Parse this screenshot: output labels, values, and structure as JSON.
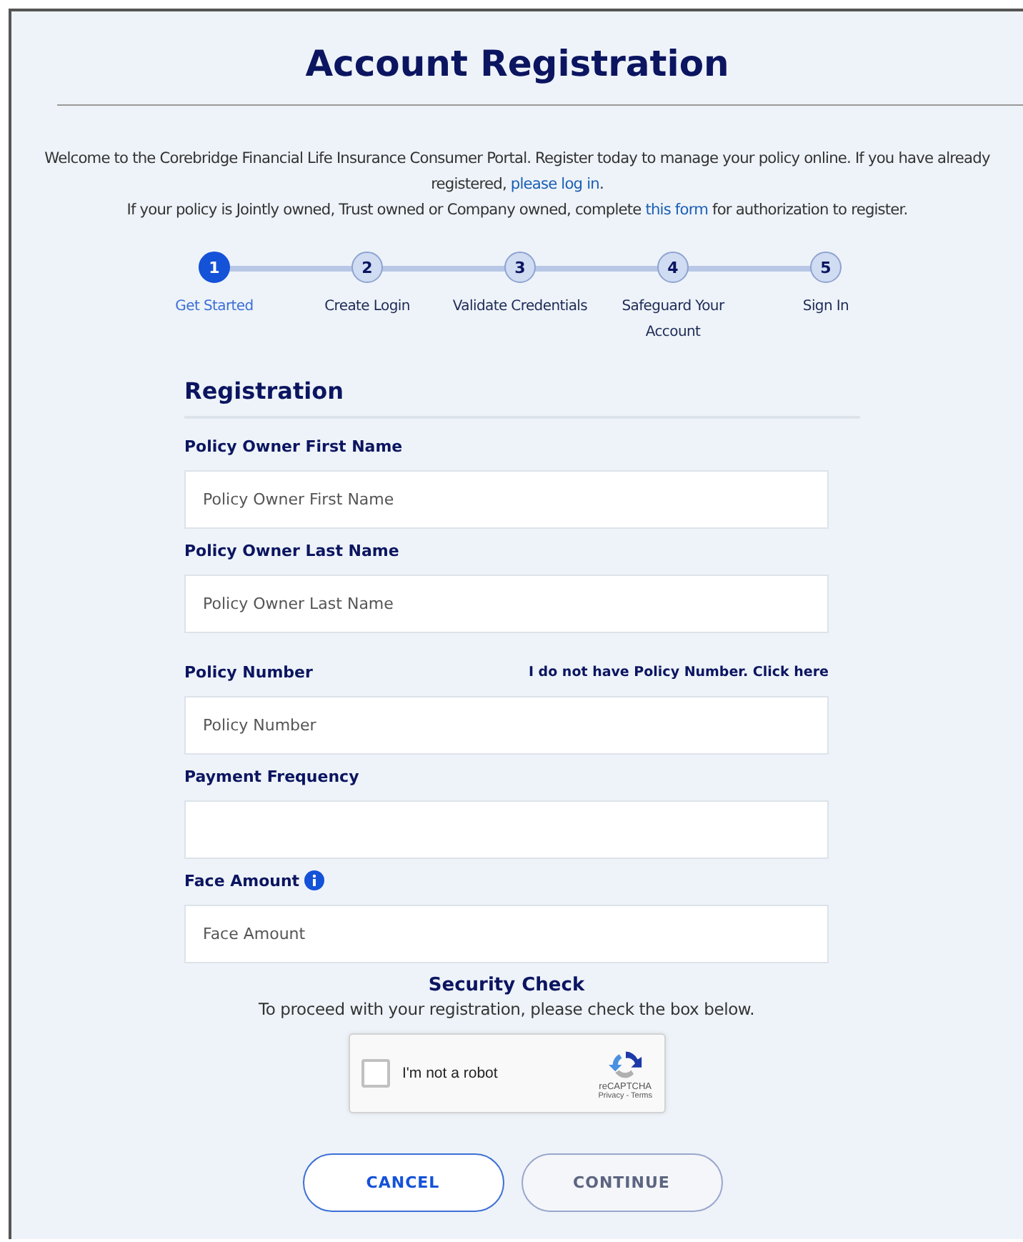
{
  "title": "Account Registration",
  "intro": {
    "text": "Welcome to the Corebridge Financial Life Insurance Consumer Portal. Register today to manage your policy online. If you have already registered, ",
    "link": "please log in",
    "after": "."
  },
  "intro2": {
    "text": "If your policy is Jointly owned, Trust owned or Company owned, complete ",
    "link": "this form",
    "after": " for authorization to register."
  },
  "steps": [
    {
      "number": "1",
      "label": "Get Started",
      "selected": true
    },
    {
      "number": "2",
      "label": "Create Login",
      "selected": false
    },
    {
      "number": "3",
      "label": "Validate Credentials",
      "selected": false
    },
    {
      "number": "4",
      "label": "Safeguard Your Account",
      "selected": false
    },
    {
      "number": "5",
      "label": "Sign In",
      "selected": false
    }
  ],
  "section_title": "Registration",
  "fields": [
    {
      "label": "Policy Owner First Name",
      "placeholder": "Policy Owner First Name"
    },
    {
      "label": "Policy Owner Last Name",
      "placeholder": "Policy Owner Last Name"
    },
    {
      "label": "Policy Number",
      "placeholder": "Policy Number",
      "link": "I do not have Policy Number. Click here"
    },
    {
      "label": "Payment Frequency"
    },
    {
      "label": "Face Amount",
      "placeholder": "Face Amount",
      "info": true
    }
  ],
  "security": {
    "title": "Security Check",
    "text": "To proceed with your registration, please check the box below.",
    "checkbox_label": "I'm not a robot",
    "checked": false,
    "brand": "reCAPTCHA",
    "terms": "Privacy - Terms"
  },
  "buttons": [
    {
      "label": "CANCEL",
      "disabled": false
    },
    {
      "label": "CONTINUE",
      "disabled": true
    }
  ]
}
